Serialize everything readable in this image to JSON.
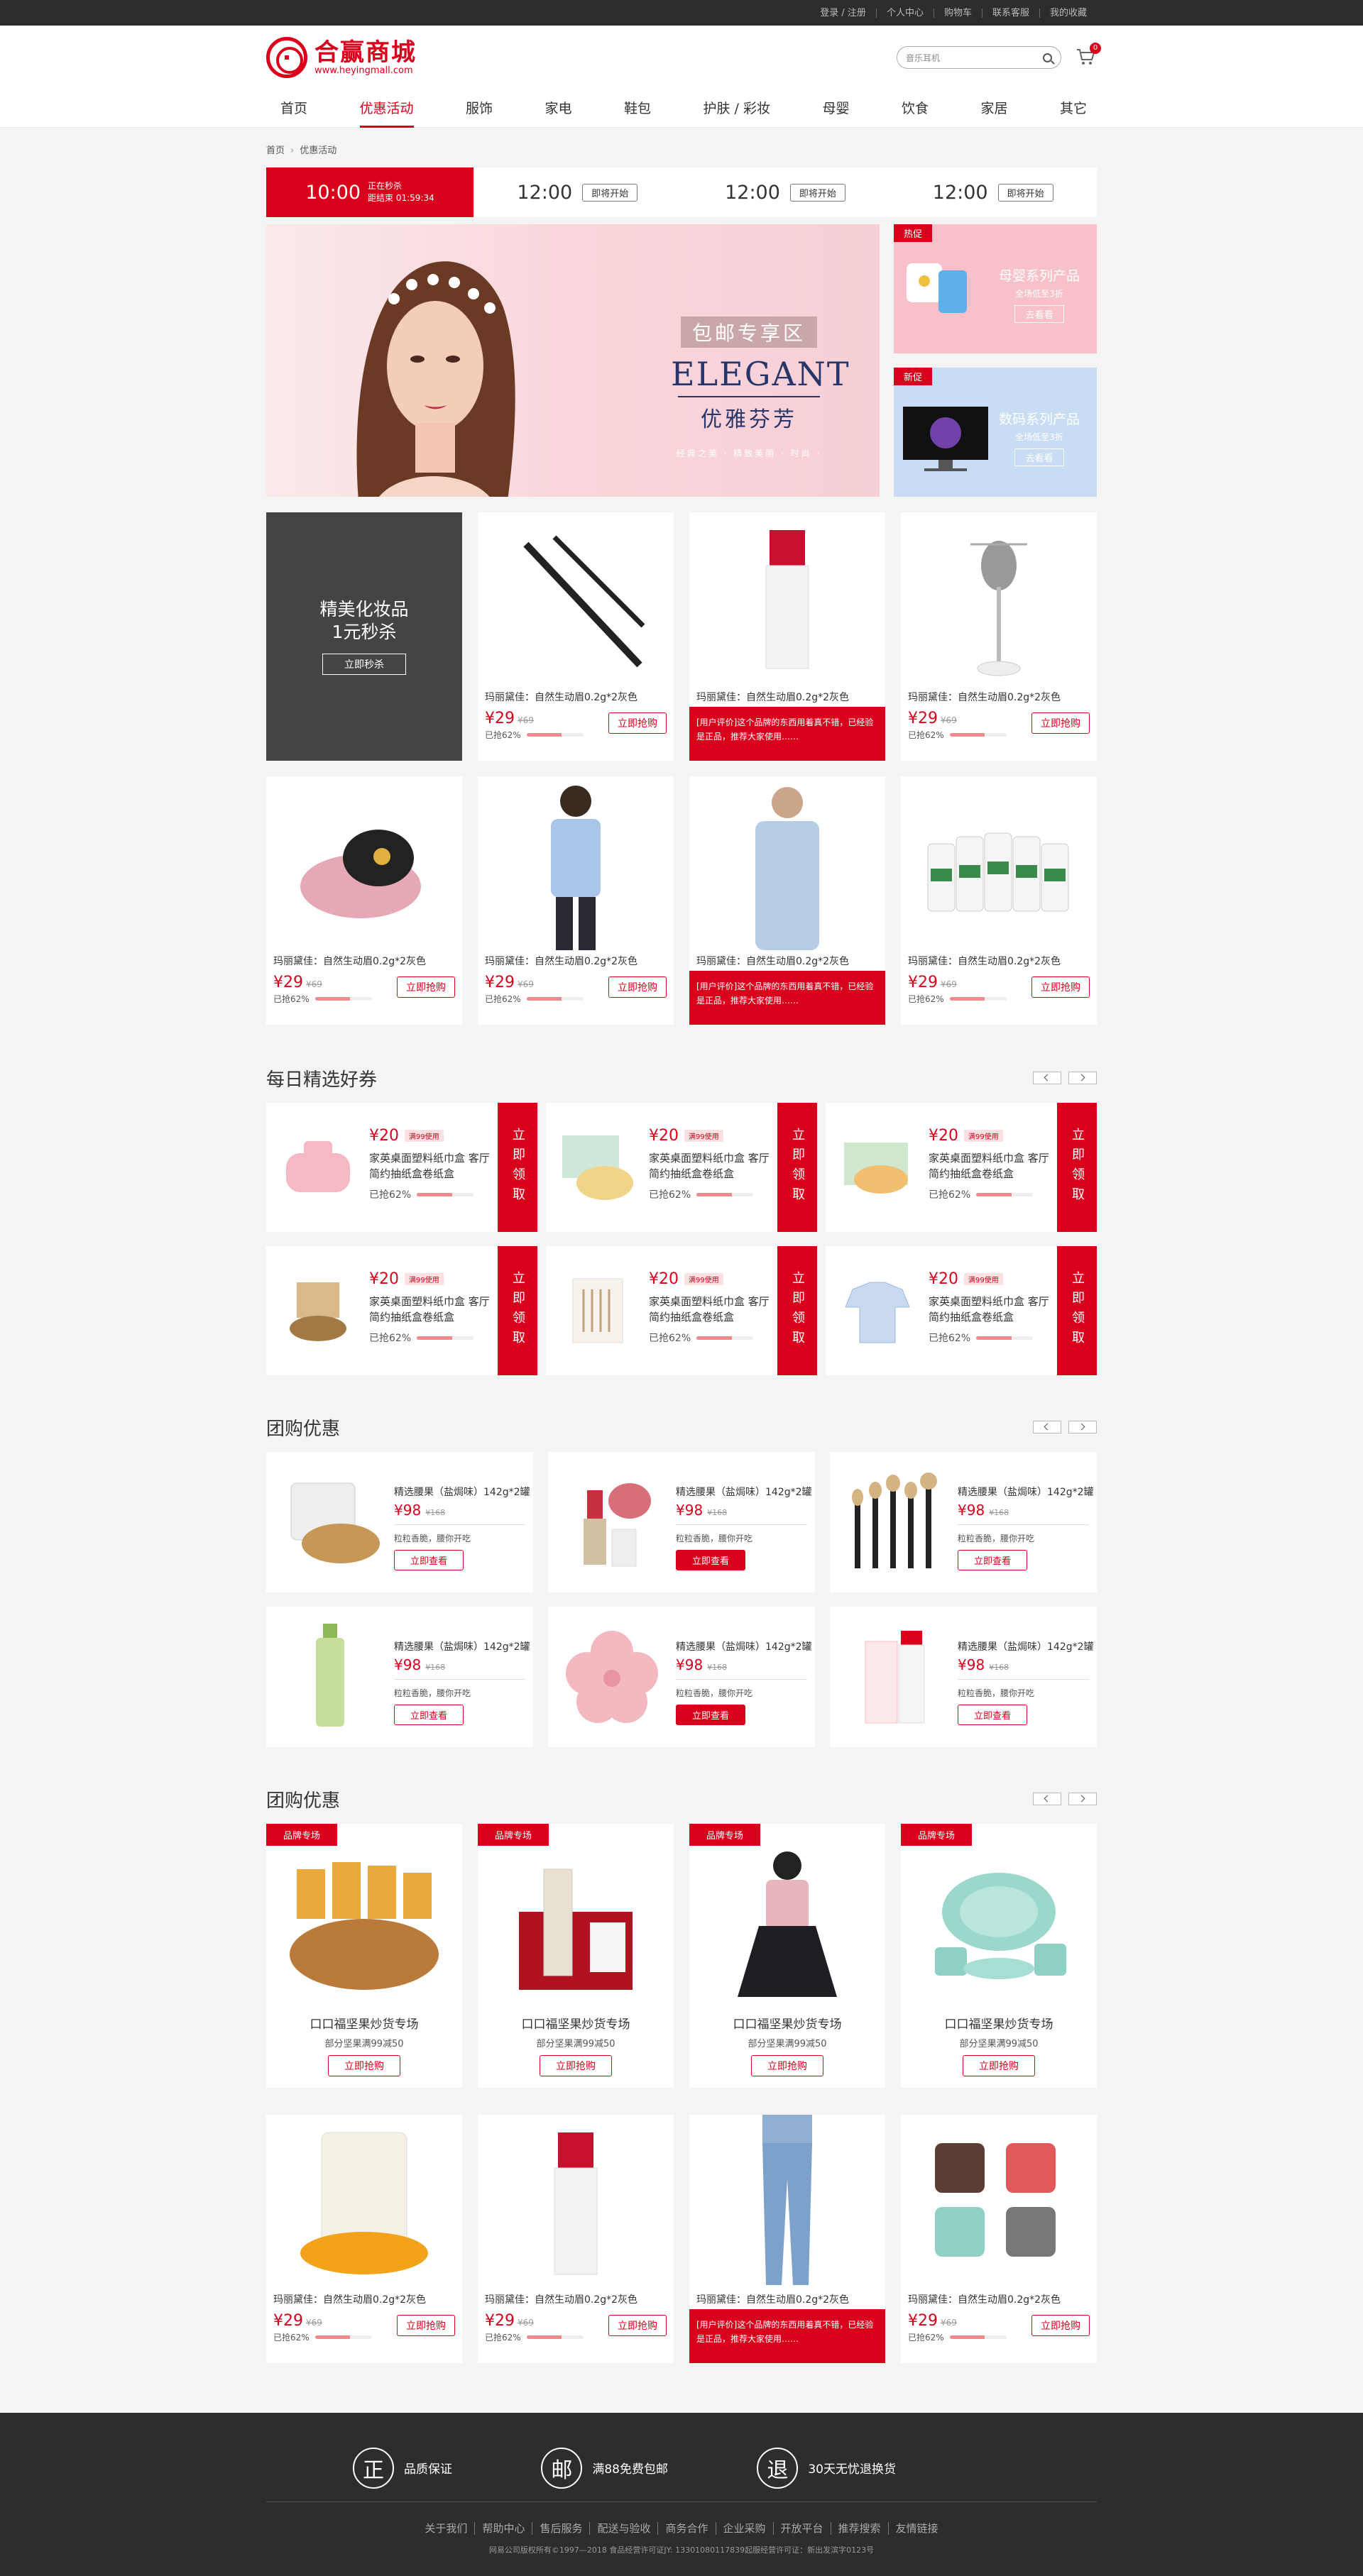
{
  "topbar": {
    "links": [
      "登录 / 注册",
      "个人中心",
      "购物车",
      "联系客服",
      "我的收藏"
    ]
  },
  "header": {
    "logo_name": "合赢商城",
    "logo_url": "www.heyingmall.com",
    "search_placeholder": "音乐耳机",
    "cart_count": "0"
  },
  "nav": [
    "首页",
    "优惠活动",
    "服饰",
    "家电",
    "鞋包",
    "护肤 / 彩妆",
    "母婴",
    "饮食",
    "家居",
    "其它"
  ],
  "breadcrumb": [
    "首页",
    "优惠活动"
  ],
  "flash": [
    {
      "time": "10:00",
      "status": "正在秒杀",
      "sub": "距结束 01:59:34"
    },
    {
      "time": "12:00",
      "status": "即将开始"
    },
    {
      "time": "12:00",
      "status": "即将开始"
    },
    {
      "time": "12:00",
      "status": "即将开始"
    }
  ],
  "banner": {
    "tag": "包邮专享区",
    "title": "ELEGANT",
    "subtitle": "优雅芬芳",
    "slogan": "经典之美 · 精致美丽 · 时尚 ·"
  },
  "side": [
    {
      "tag": "热促",
      "title": "母婴系列产品",
      "sub": "全场低至3折",
      "btn": "去看看"
    },
    {
      "tag": "新促",
      "title": "数码系列产品",
      "sub": "全场低至3折",
      "btn": "去看看"
    }
  ],
  "promo": {
    "line1": "精美化妆品",
    "line2": "1元秒杀",
    "btn": "立即秒杀"
  },
  "products": [
    {
      "name": "玛丽黛佳：自然生动眉0.2g*2灰色",
      "price": "¥29",
      "old": "¥69",
      "sold": "已抢62%",
      "btn": "立即抢购"
    },
    {
      "name": "玛丽黛佳：自然生动眉0.2g*2灰色",
      "review": "[用户评价]这个品牌的东西用着真不错，已经验是正品，推荐大家使用……"
    },
    {
      "name": "玛丽黛佳：自然生动眉0.2g*2灰色",
      "price": "¥29",
      "old": "¥69",
      "sold": "已抢62%",
      "btn": "立即抢购"
    },
    {
      "name": "玛丽黛佳：自然生动眉0.2g*2灰色",
      "price": "¥29",
      "old": "¥69",
      "sold": "已抢62%",
      "btn": "立即抢购"
    },
    {
      "name": "玛丽黛佳：自然生动眉0.2g*2灰色",
      "price": "¥29",
      "old": "¥69",
      "sold": "已抢62%",
      "btn": "立即抢购"
    },
    {
      "name": "玛丽黛佳：自然生动眉0.2g*2灰色",
      "review": "[用户评价]这个品牌的东西用着真不错，已经验是正品，推荐大家使用……"
    },
    {
      "name": "玛丽黛佳：自然生动眉0.2g*2灰色",
      "price": "¥29",
      "old": "¥69",
      "sold": "已抢62%",
      "btn": "立即抢购"
    }
  ],
  "coupons_section": {
    "title": "每日精选好券"
  },
  "coupon": {
    "price": "¥20",
    "tag": "满99使用",
    "name": "家英桌面塑料纸巾盒 客厅简约抽纸盒卷纸盒",
    "sold": "已抢62%",
    "take": "立即领取"
  },
  "group_section": {
    "title": "团购优惠"
  },
  "group": {
    "name": "精选腰果（盐焗味）142g*2罐",
    "price": "¥98",
    "old": "¥168",
    "desc": "粒粒香脆，腰你开吃",
    "btn": "立即查看"
  },
  "brand_section": {
    "title": "团购优惠"
  },
  "brand": {
    "tag": "品牌专场",
    "name": "口口福坚果炒货专场",
    "desc": "部分坚果满99减50",
    "btn": "立即抢购"
  },
  "bottom_products": [
    {
      "name": "玛丽黛佳：自然生动眉0.2g*2灰色",
      "price": "¥29",
      "old": "¥69",
      "sold": "已抢62%",
      "btn": "立即抢购"
    },
    {
      "name": "玛丽黛佳：自然生动眉0.2g*2灰色",
      "price": "¥29",
      "old": "¥69",
      "sold": "已抢62%",
      "btn": "立即抢购"
    },
    {
      "name": "玛丽黛佳：自然生动眉0.2g*2灰色",
      "review": "[用户评价]这个品牌的东西用着真不错，已经验是正品，推荐大家使用……"
    },
    {
      "name": "玛丽黛佳：自然生动眉0.2g*2灰色",
      "price": "¥29",
      "old": "¥69",
      "sold": "已抢62%",
      "btn": "立即抢购"
    }
  ],
  "footer": {
    "guarantees": [
      {
        "icon": "正",
        "text": "品质保证"
      },
      {
        "icon": "邮",
        "text": "满88免费包邮"
      },
      {
        "icon": "退",
        "text": "30天无忧退换货"
      }
    ],
    "links": [
      "关于我们",
      "帮助中心",
      "售后服务",
      "配送与验收",
      "商务合作",
      "企业采购",
      "开放平台",
      "推荐搜索",
      "友情链接"
    ],
    "copyright": "网易公司版权所有©1997—2018  食品经营许可证JY: 13301080117839起服经营许可证：新出发滨字0123号"
  },
  "colors": {
    "accent": "#d9001b",
    "dark": "#2d2d2d"
  }
}
